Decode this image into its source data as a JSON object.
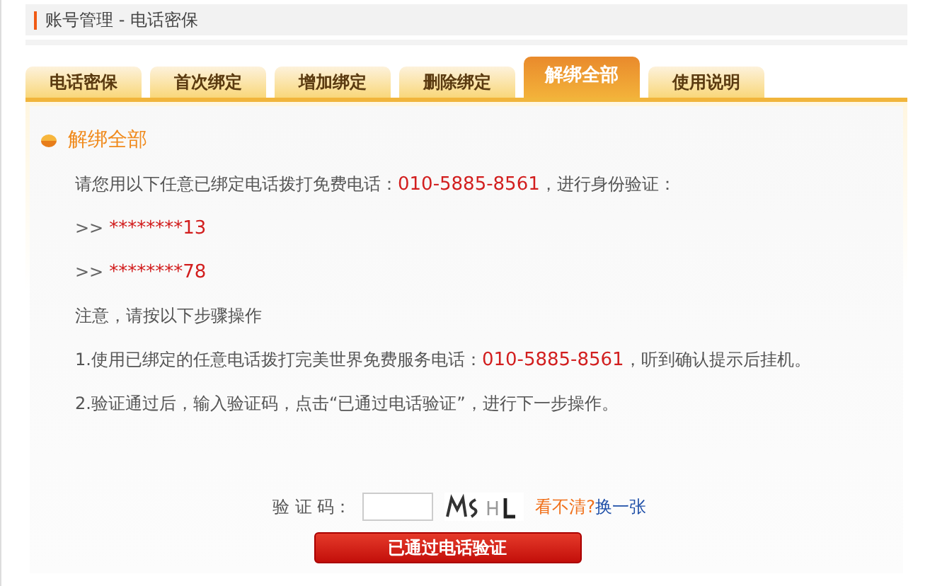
{
  "breadcrumb": "账号管理 - 电话密保",
  "tabs": [
    {
      "label": "电话密保",
      "selected": false
    },
    {
      "label": "首次绑定",
      "selected": false
    },
    {
      "label": "增加绑定",
      "selected": false
    },
    {
      "label": "删除绑定",
      "selected": false
    },
    {
      "label": "解绑全部",
      "selected": true
    },
    {
      "label": "使用说明",
      "selected": false
    }
  ],
  "section_title": "解绑全部",
  "lines": [
    {
      "kind": "text",
      "parts": [
        {
          "text": "请您用以下任意已绑定电话拨打免费电话：",
          "highlight": false
        },
        {
          "text": "010-5885-8561",
          "highlight": true
        },
        {
          "text": "，进行身份验证：",
          "highlight": false
        }
      ]
    },
    {
      "kind": "phone",
      "prefix": ">>",
      "number": "********13"
    },
    {
      "kind": "phone",
      "prefix": ">>",
      "number": "********78"
    },
    {
      "kind": "text",
      "parts": [
        {
          "text": "注意，请按以下步骤操作",
          "highlight": false
        }
      ]
    },
    {
      "kind": "text",
      "parts": [
        {
          "text": "1.使用已绑定的任意电话拨打完美世界免费服务电话：",
          "highlight": false
        },
        {
          "text": "010-5885-8561",
          "highlight": true
        },
        {
          "text": "，听到确认提示后挂机。",
          "highlight": false
        }
      ]
    },
    {
      "kind": "text",
      "parts": [
        {
          "text": "2.验证通过后，输入验证码，点击“已通过电话验证”，进行下一步操作。",
          "highlight": false
        }
      ]
    }
  ],
  "captcha": {
    "label": "验 证 码：",
    "hint": "看不清?",
    "refresh": "换一张"
  },
  "submit": "已通过电话验证"
}
